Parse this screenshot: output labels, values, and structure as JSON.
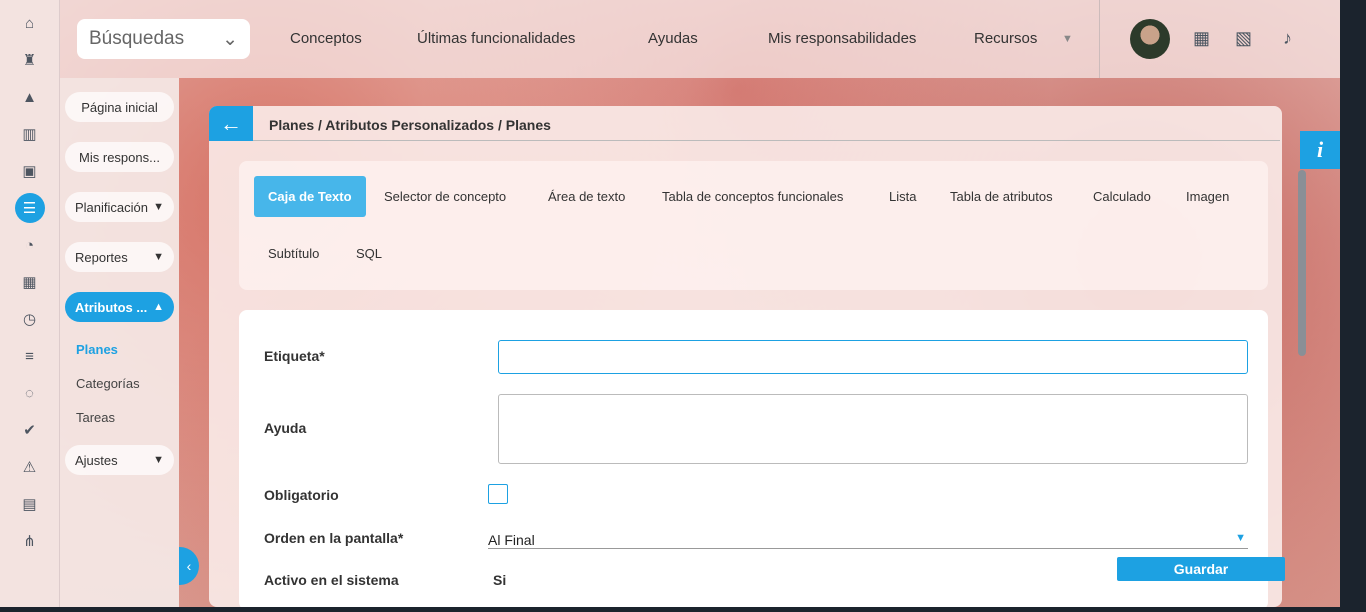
{
  "search": {
    "label": "Búsquedas"
  },
  "nav": {
    "items": [
      "Conceptos",
      "Últimas funcionalidades",
      "Ayudas",
      "Mis responsabilidades",
      "Recursos"
    ]
  },
  "sidebar": {
    "home": "Página inicial",
    "resp": "Mis respons...",
    "planning": "Planificación",
    "reports": "Reportes",
    "attributes": "Atributos ...",
    "sub_plans": "Planes",
    "sub_categories": "Categorías",
    "sub_tasks": "Tareas",
    "settings": "Ajustes"
  },
  "breadcrumb": "Planes / Atributos Personalizados / Planes",
  "tabs": [
    "Caja de Texto",
    "Selector de concepto",
    "Área de texto",
    "Tabla de conceptos funcionales",
    "Lista",
    "Tabla de atributos",
    "Calculado",
    "Imagen",
    "Subtítulo",
    "SQL"
  ],
  "form": {
    "label_etiqueta": "Etiqueta*",
    "label_ayuda": "Ayuda",
    "label_obligatorio": "Obligatorio",
    "label_orden": "Orden en la pantalla*",
    "orden_value": "Al Final",
    "label_activo": "Activo en el sistema",
    "activo_value": "Si",
    "obligatorio_checked": false,
    "etiqueta_value": "",
    "ayuda_value": ""
  },
  "actions": {
    "save": "Guardar"
  },
  "colors": {
    "accent": "#1da1e2"
  }
}
